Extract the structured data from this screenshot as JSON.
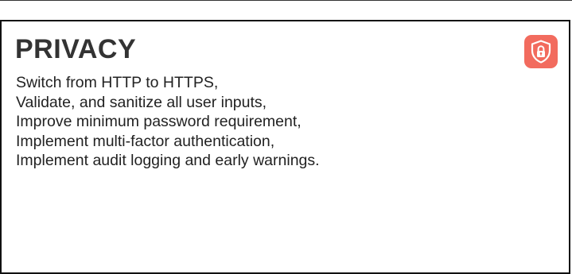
{
  "card": {
    "title": "PRIVACY",
    "icon": "shield-lock-icon",
    "accent_color": "#f26b5e",
    "lines": [
      "Switch from HTTP to HTTPS,",
      "Validate, and sanitize all user inputs,",
      "Improve minimum password requirement,",
      "Implement multi-factor authentication,",
      "Implement audit logging and early warnings."
    ]
  }
}
